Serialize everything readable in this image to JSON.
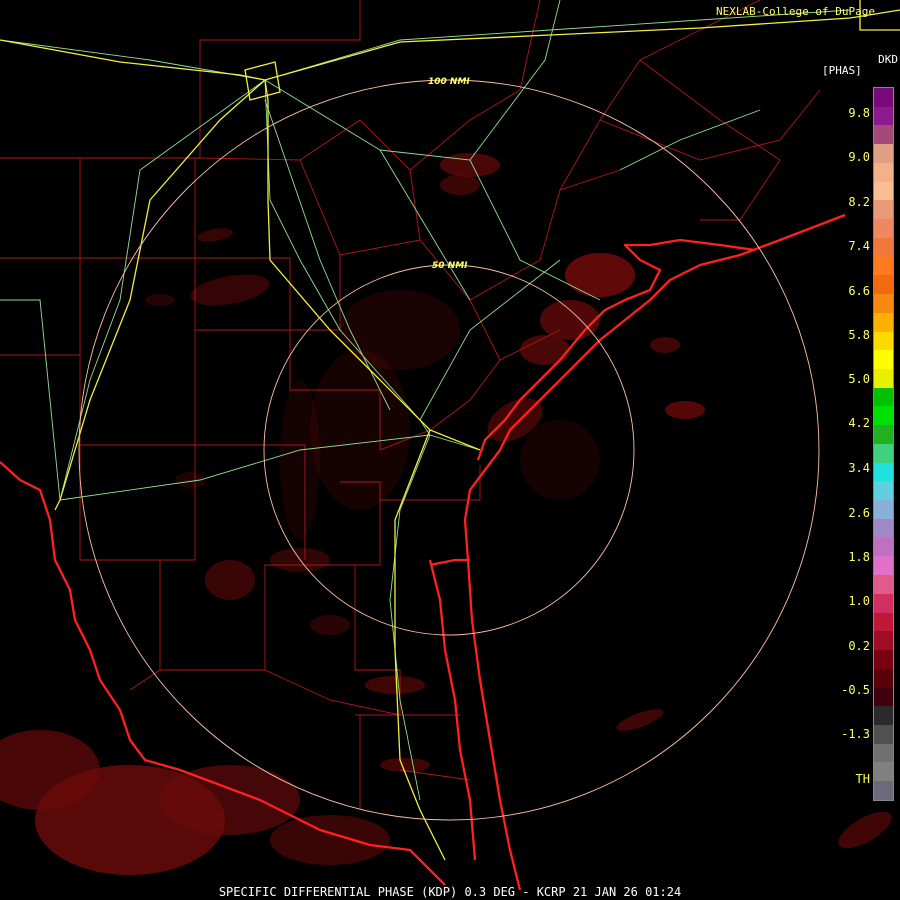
{
  "header": {
    "credit": "NEXLAB-College of DuPage",
    "product_code": "DKD",
    "product_unit": "[PHAS]"
  },
  "range_rings": [
    {
      "label": "100 NMI"
    },
    {
      "label": "50 NMI"
    }
  ],
  "color_scale": {
    "labels": [
      "9.8",
      "9.0",
      "8.2",
      "7.4",
      "6.6",
      "5.8",
      "5.0",
      "4.2",
      "3.4",
      "2.6",
      "1.8",
      "1.0",
      "0.2",
      "-0.5",
      "-1.3",
      "TH"
    ],
    "segments": [
      "#7a0a7a",
      "#8c1a8c",
      "#a44a7a",
      "#e0a088",
      "#f4b088",
      "#f8c090",
      "#e89a78",
      "#ee8860",
      "#f07838",
      "#ff7a1a",
      "#f26a10",
      "#f48a10",
      "#ffb000",
      "#ffd800",
      "#ffff00",
      "#e8f000",
      "#00c000",
      "#00e000",
      "#20b020",
      "#40d080",
      "#20e0e0",
      "#60d0e0",
      "#8ab0d8",
      "#a088c8",
      "#c070c0",
      "#e070c8",
      "#e05a8a",
      "#d03060",
      "#c01838",
      "#a00c20",
      "#780010",
      "#5a0008",
      "#400010",
      "#2a2a2a",
      "#505050",
      "#707070",
      "#808080",
      "#6a6a7a"
    ],
    "colors": {
      "map_lines": "#c01818",
      "coast": "#ff2020",
      "highways": "#ffff60",
      "roads": "#90e090",
      "rings": "#ffc0a0",
      "echo": "#6a0a0a"
    }
  },
  "footer": {
    "caption": "SPECIFIC DIFFERENTIAL PHASE (KDP) 0.3 DEG - KCRP 21 JAN 26 01:24"
  }
}
